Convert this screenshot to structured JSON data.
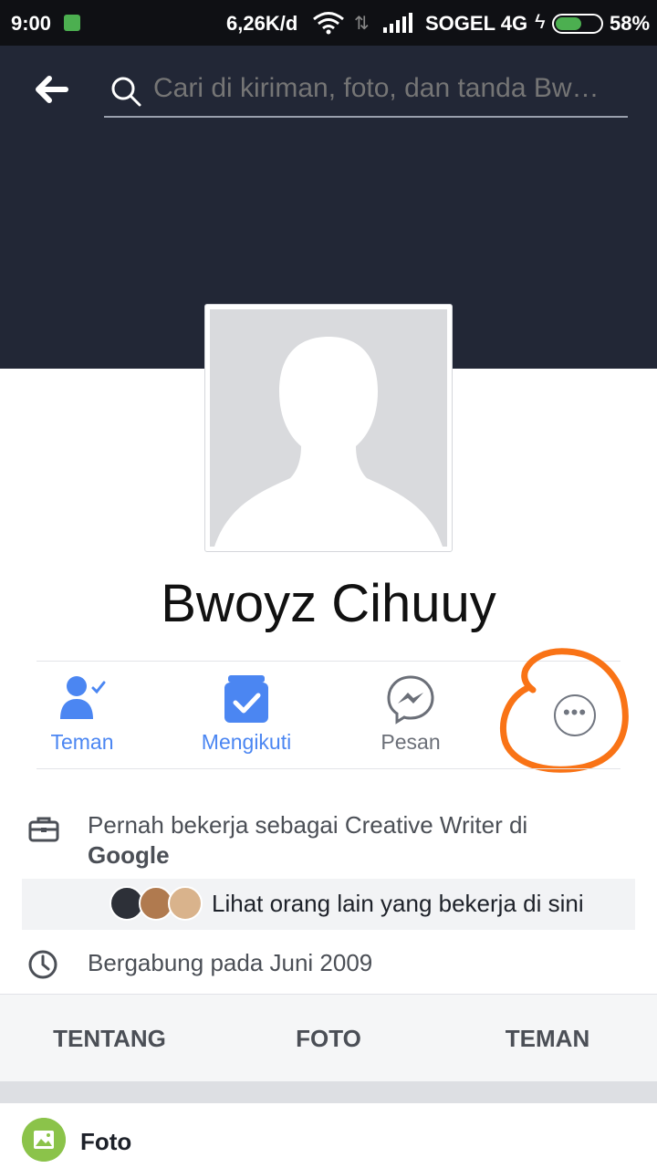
{
  "status_bar": {
    "time": "9:00",
    "speed": "6,26K/d",
    "carrier": "SOGEL 4G",
    "battery_percent": "58%",
    "battery_level": 0.58,
    "icons": [
      "notification-icon",
      "wifi-icon",
      "data-arrows-icon",
      "signal-icon",
      "charging-icon",
      "battery-icon"
    ]
  },
  "header": {
    "back_icon": "arrow-left-icon",
    "search": {
      "placeholder": "Cari di kiriman, foto, dan tanda Bw…",
      "icon": "search-icon"
    }
  },
  "profile": {
    "name": "Bwoyz Cihuuy",
    "picture": "default-silhouette"
  },
  "actions": {
    "friends": {
      "label": "Teman",
      "icon": "friend-check-icon"
    },
    "following": {
      "label": "Mengikuti",
      "icon": "following-check-icon"
    },
    "message": {
      "label": "Pesan",
      "icon": "messenger-icon"
    },
    "more": {
      "icon": "more-icon"
    }
  },
  "info": {
    "work_prefix": "Pernah bekerja sebagai  Creative Writer di",
    "work_company": "Google",
    "coworkers_text": "Lihat orang lain yang bekerja di sini",
    "joined": "Bergabung pada Juni 2009"
  },
  "tabs": {
    "about": "TENTANG",
    "photos": "FOTO",
    "friends": "TEMAN"
  },
  "photo_section": {
    "title": "Foto"
  },
  "colors": {
    "cover": "#222736",
    "accent": "#4b86f2",
    "annotation": "#f97316"
  }
}
